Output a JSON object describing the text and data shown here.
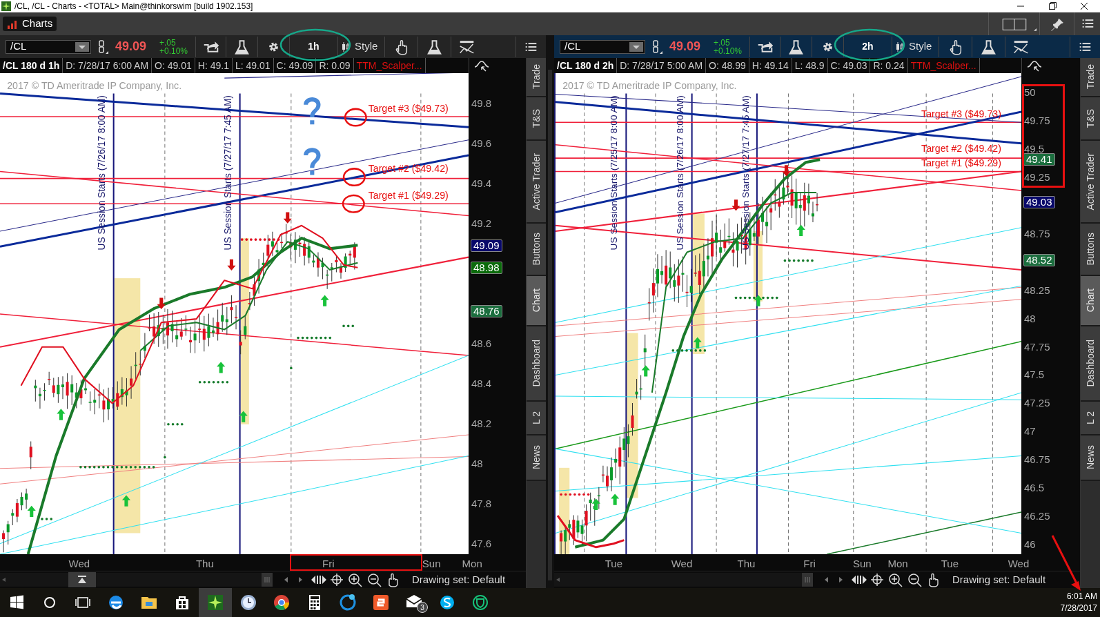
{
  "window": {
    "title": "/CL, /CL - Charts - <TOTAL> Main@thinkorswim [build 1902.153]"
  },
  "tabs": [
    {
      "label": "Charts",
      "selected": true
    }
  ],
  "panes": [
    {
      "active": false,
      "symbol": "/CL",
      "last": "49.09",
      "change": "+.05",
      "change_percent": "+0.10%",
      "timeframe": "1h",
      "style": "Style",
      "info": [
        "/CL 180 d 1h",
        "D: 7/28/17 6:00 AM",
        "O: 49.01",
        "H: 49.1",
        "L: 49.01",
        "C: 49.09",
        "R: 0.09",
        "TTM_Scalper..."
      ],
      "copyright": "2017 © TD Ameritrade IP Company, Inc.",
      "session_labels": [
        "US Session Starts (7/26/17 8:00 AM)",
        "US Session Starts (7/27/17 7:45 AM)"
      ],
      "targets": [
        "Target #3 ($49.73)",
        "Target #2 ($49.42)",
        "Target #1 ($49.29)"
      ],
      "price_ticks": [
        "49.8",
        "49.6",
        "49.4",
        "49.2",
        "48.6",
        "48.4",
        "48.2",
        "48",
        "47.8",
        "47.6"
      ],
      "badges": [
        {
          "text": "49.09",
          "color": "#08086a"
        },
        {
          "text": "48.98",
          "color": "#0b6b0b"
        },
        {
          "text": "48.76",
          "color": "#1b6e3e"
        }
      ],
      "days": [
        "Wed",
        "Thu",
        "Fri",
        "Sun",
        "Mon"
      ],
      "drawing_set": "Drawing set: Default",
      "side_tabs": [
        {
          "label": "Trade",
          "selected": false
        },
        {
          "label": "T&S",
          "selected": false
        },
        {
          "label": "Active Trader",
          "selected": false
        },
        {
          "label": "Buttons",
          "selected": false
        },
        {
          "label": "Chart",
          "selected": true
        },
        {
          "label": "Dashboard",
          "selected": false
        },
        {
          "label": "L 2",
          "selected": false
        },
        {
          "label": "News",
          "selected": false
        }
      ]
    },
    {
      "active": true,
      "symbol": "/CL",
      "last": "49.09",
      "change": "+.05",
      "change_percent": "+0.10%",
      "timeframe": "2h",
      "style": "Style",
      "info": [
        "/CL 180 d 2h",
        "D: 7/28/17 5:00 AM",
        "O: 48.99",
        "H: 49.14",
        "L: 48.9",
        "C: 49.03",
        "R: 0.24",
        "TTM_Scalper..."
      ],
      "copyright": "2017 © TD Ameritrade IP Company, Inc.",
      "session_labels": [
        "US Session Starts (7/25/17 8:00 AM)",
        "US Session Starts (7/26/17 8:00 AM)",
        "US Session Starts (7/27/17 7:45 AM)"
      ],
      "targets": [
        "Target #3 ($49.73)",
        "Target #2 ($49.42)",
        "Target #1 ($49.29)"
      ],
      "price_ticks": [
        "50",
        "49.75",
        "49.5",
        "49.25",
        "48.75",
        "48.25",
        "48",
        "47.75",
        "47.5",
        "47.25",
        "47",
        "46.75",
        "46.5",
        "46.25",
        "46"
      ],
      "badges": [
        {
          "text": "49.41",
          "color": "#1b6e3e"
        },
        {
          "text": "49.03",
          "color": "#08086a"
        },
        {
          "text": "48.52",
          "color": "#1b6e3e"
        }
      ],
      "days": [
        "Tue",
        "Wed",
        "Thu",
        "Fri",
        "Sun",
        "Mon",
        "Tue",
        "Wed"
      ],
      "drawing_set": "Drawing set: Default",
      "side_tabs": [
        {
          "label": "Trade",
          "selected": false
        },
        {
          "label": "T&S",
          "selected": false
        },
        {
          "label": "Active Trader",
          "selected": false
        },
        {
          "label": "Buttons",
          "selected": false
        },
        {
          "label": "Chart",
          "selected": true
        },
        {
          "label": "Dashboard",
          "selected": false
        },
        {
          "label": "L 2",
          "selected": false
        },
        {
          "label": "News",
          "selected": false
        }
      ]
    }
  ],
  "taskbar": {
    "time": "6:01 AM",
    "date": "7/28/2017",
    "mail_count": "3"
  }
}
